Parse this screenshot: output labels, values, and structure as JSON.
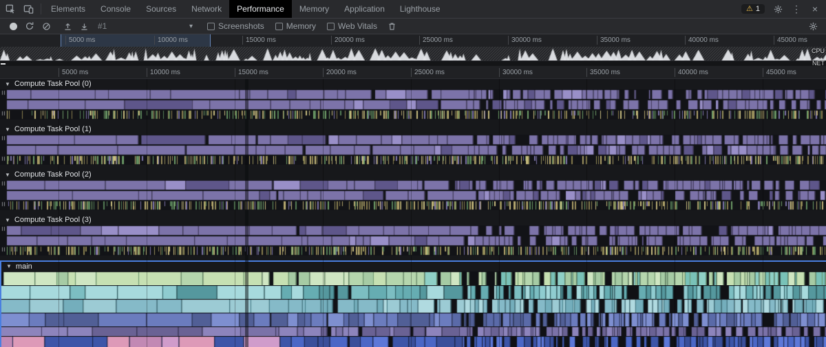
{
  "titlebar": {
    "tabs": [
      "Elements",
      "Console",
      "Sources",
      "Network",
      "Performance",
      "Memory",
      "Application",
      "Lighthouse"
    ],
    "active_tab": "Performance",
    "warning_count": "1"
  },
  "toolbar": {
    "history_selector": "#1",
    "checkboxes": [
      {
        "label": "Screenshots",
        "checked": false
      },
      {
        "label": "Memory",
        "checked": false
      },
      {
        "label": "Web Vitals",
        "checked": false
      }
    ]
  },
  "time_ticks": [
    "5000 ms",
    "10000 ms",
    "15000 ms",
    "20000 ms",
    "25000 ms",
    "30000 ms",
    "35000 ms",
    "40000 ms",
    "45000 ms"
  ],
  "overview": {
    "cpu_label": "CPU",
    "net_label": "NET"
  },
  "tracks": [
    {
      "label": "Compute Task Pool (0)",
      "type": "pool"
    },
    {
      "label": "Compute Task Pool (1)",
      "type": "pool"
    },
    {
      "label": "Compute Task Pool (2)",
      "type": "pool"
    },
    {
      "label": "Compute Task Pool (3)",
      "type": "pool"
    },
    {
      "label": "main",
      "type": "main",
      "selected": true
    }
  ],
  "icons": {
    "collapse_arrow": "▼",
    "dropdown_caret": "▾",
    "warning": "⚠",
    "menu_dots": "⋮",
    "close": "×"
  },
  "colors": {
    "selection_accent": "#4a7fe0",
    "pool_base": "#7c73a9",
    "pool_dark": "#5e568a",
    "pool_light": "#998fc8",
    "pool_edge": "#474063",
    "tick_palette": [
      "#97905a",
      "#b3a46b",
      "#6f9e68",
      "#7c73a9",
      "#c9bd80",
      "#577f57",
      "#8a7f4f"
    ],
    "main_rows": [
      {
        "palette": [
          "#b5d6ad",
          "#c6e0b2",
          "#a6cba4",
          "#cfe6c2"
        ],
        "sep": "#6f9a70",
        "alt": {
          "palette": [
            "#8fd0c6",
            "#79c2b8"
          ],
          "from": 600,
          "to": 1200,
          "prob": 0.35
        }
      },
      {
        "palette": [
          "#7cbec2",
          "#66adb2",
          "#8fccd0",
          "#55989e",
          "#a7dadd"
        ],
        "sep": "#2f6468"
      },
      {
        "palette": [
          "#9ccbd4",
          "#85bac8",
          "#b0dae0",
          "#74aebc"
        ],
        "sep": "#47808c"
      },
      {
        "palette": [
          "#6b7cbe",
          "#5a6aa8",
          "#7e8fd0",
          "#515f96"
        ],
        "sep": "#333d66"
      },
      {
        "palette": [
          "#7b72a8",
          "#6a6294",
          "#8d84bc"
        ],
        "sep": "#453f66"
      },
      {
        "palette": [
          "#4b67c6",
          "#3d55a8",
          "#5d78d8",
          "#3a4f9a"
        ],
        "sep": "#1e2a55",
        "alt": {
          "palette": [
            "#d09ccb",
            "#c289b4",
            "#dd9ab8"
          ],
          "from": 0,
          "to": 360,
          "prob": 0.5
        }
      }
    ]
  }
}
